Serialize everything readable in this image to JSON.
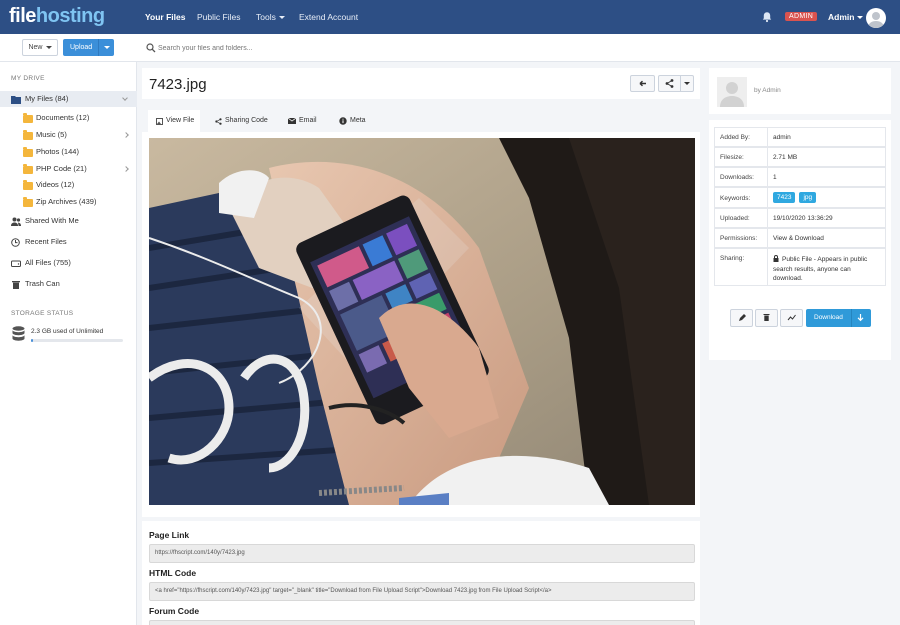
{
  "brand": {
    "part1": "file",
    "part2": "hosting"
  },
  "topnav": {
    "your_files": "Your Files",
    "public_files": "Public Files",
    "tools": "Tools",
    "extend_account": "Extend Account",
    "admin_badge": "ADMIN",
    "user": "Admin"
  },
  "toolbar": {
    "new_label": "New",
    "upload_label": "Upload",
    "search_placeholder": "Search your files and folders..."
  },
  "sidebar": {
    "my_drive_title": "MY DRIVE",
    "my_files": "My Files (84)",
    "folders": [
      {
        "label": "Documents (12)",
        "has_children": false
      },
      {
        "label": "Music (5)",
        "has_children": true
      },
      {
        "label": "Photos (144)",
        "has_children": false
      },
      {
        "label": "PHP Code (21)",
        "has_children": true
      },
      {
        "label": "Videos (12)",
        "has_children": false
      },
      {
        "label": "Zip Archives (439)",
        "has_children": false
      }
    ],
    "shared_with_me": "Shared With Me",
    "recent_files": "Recent Files",
    "all_files": "All Files (755)",
    "trash_can": "Trash Can",
    "storage_title": "STORAGE STATUS",
    "storage_text": "2.3 GB used of Unlimited",
    "storage_fraction": 0.02
  },
  "file": {
    "title": "7423.jpg",
    "tabs": [
      "View File",
      "Sharing Code",
      "Email",
      "Meta"
    ],
    "active_tab": 0
  },
  "links": {
    "page_link_title": "Page Link",
    "page_link_value": "https://fhscript.com/140y/7423.jpg",
    "html_code_title": "HTML Code",
    "html_code_value": "<a href=\"https://fhscript.com/140y/7423.jpg\" target=\"_blank\" title=\"Download from File Upload Script\">Download 7423.jpg from File Upload Script</a>",
    "forum_code_title": "Forum Code"
  },
  "owner": {
    "by": "by Admin"
  },
  "details": {
    "added_by_label": "Added By:",
    "added_by": "admin",
    "filesize_label": "Filesize:",
    "filesize": "2.71 MB",
    "downloads_label": "Downloads:",
    "downloads": "1",
    "keywords_label": "Keywords:",
    "keywords": [
      "7423",
      "jpg"
    ],
    "uploaded_label": "Uploaded:",
    "uploaded": "19/10/2020 13:36:29",
    "permissions_label": "Permissions:",
    "permissions": "View & Download",
    "sharing_label": "Sharing:",
    "sharing": "Public File - Appears in public search results, anyone can download."
  },
  "actions": {
    "download_label": "Download"
  },
  "colors": {
    "topbar": "#2d4f85",
    "accent": "#3b8fd9",
    "badge": "#d9534f",
    "keyword": "#2fa8e0",
    "folder": "#f4b63c"
  }
}
